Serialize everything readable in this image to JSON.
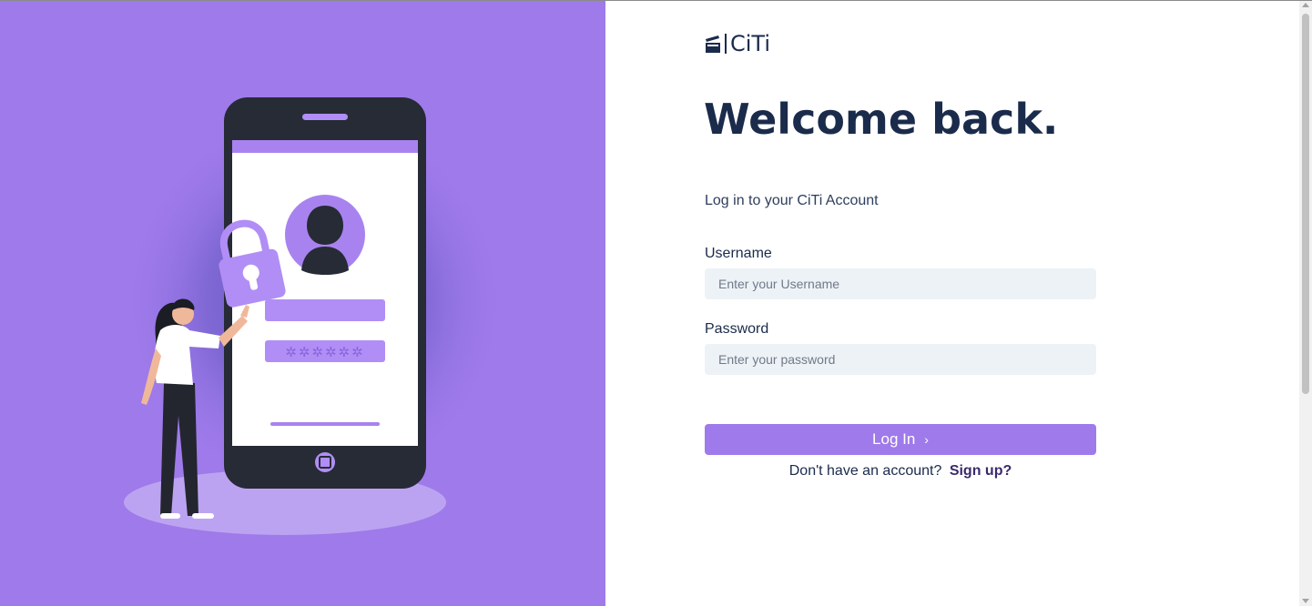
{
  "brand": {
    "logo_text": "CiTi",
    "accent_color": "#9f7aea",
    "text_color": "#1a2b4b"
  },
  "login": {
    "title": "Welcome back.",
    "subtitle": "Log in to your CiTi Account",
    "username": {
      "label": "Username",
      "placeholder": "Enter your Username",
      "value": ""
    },
    "password": {
      "label": "Password",
      "placeholder": "Enter your password",
      "value": ""
    },
    "submit_label": "Log In",
    "submit_icon": "chevron-right-icon",
    "signup_prompt": "Don't have an account?",
    "signup_link": "Sign up?"
  },
  "illustration": {
    "masked_password": "✲✲✲✲✲✲",
    "icons": [
      "padlock-icon",
      "user-avatar-icon",
      "smartphone-icon"
    ]
  }
}
